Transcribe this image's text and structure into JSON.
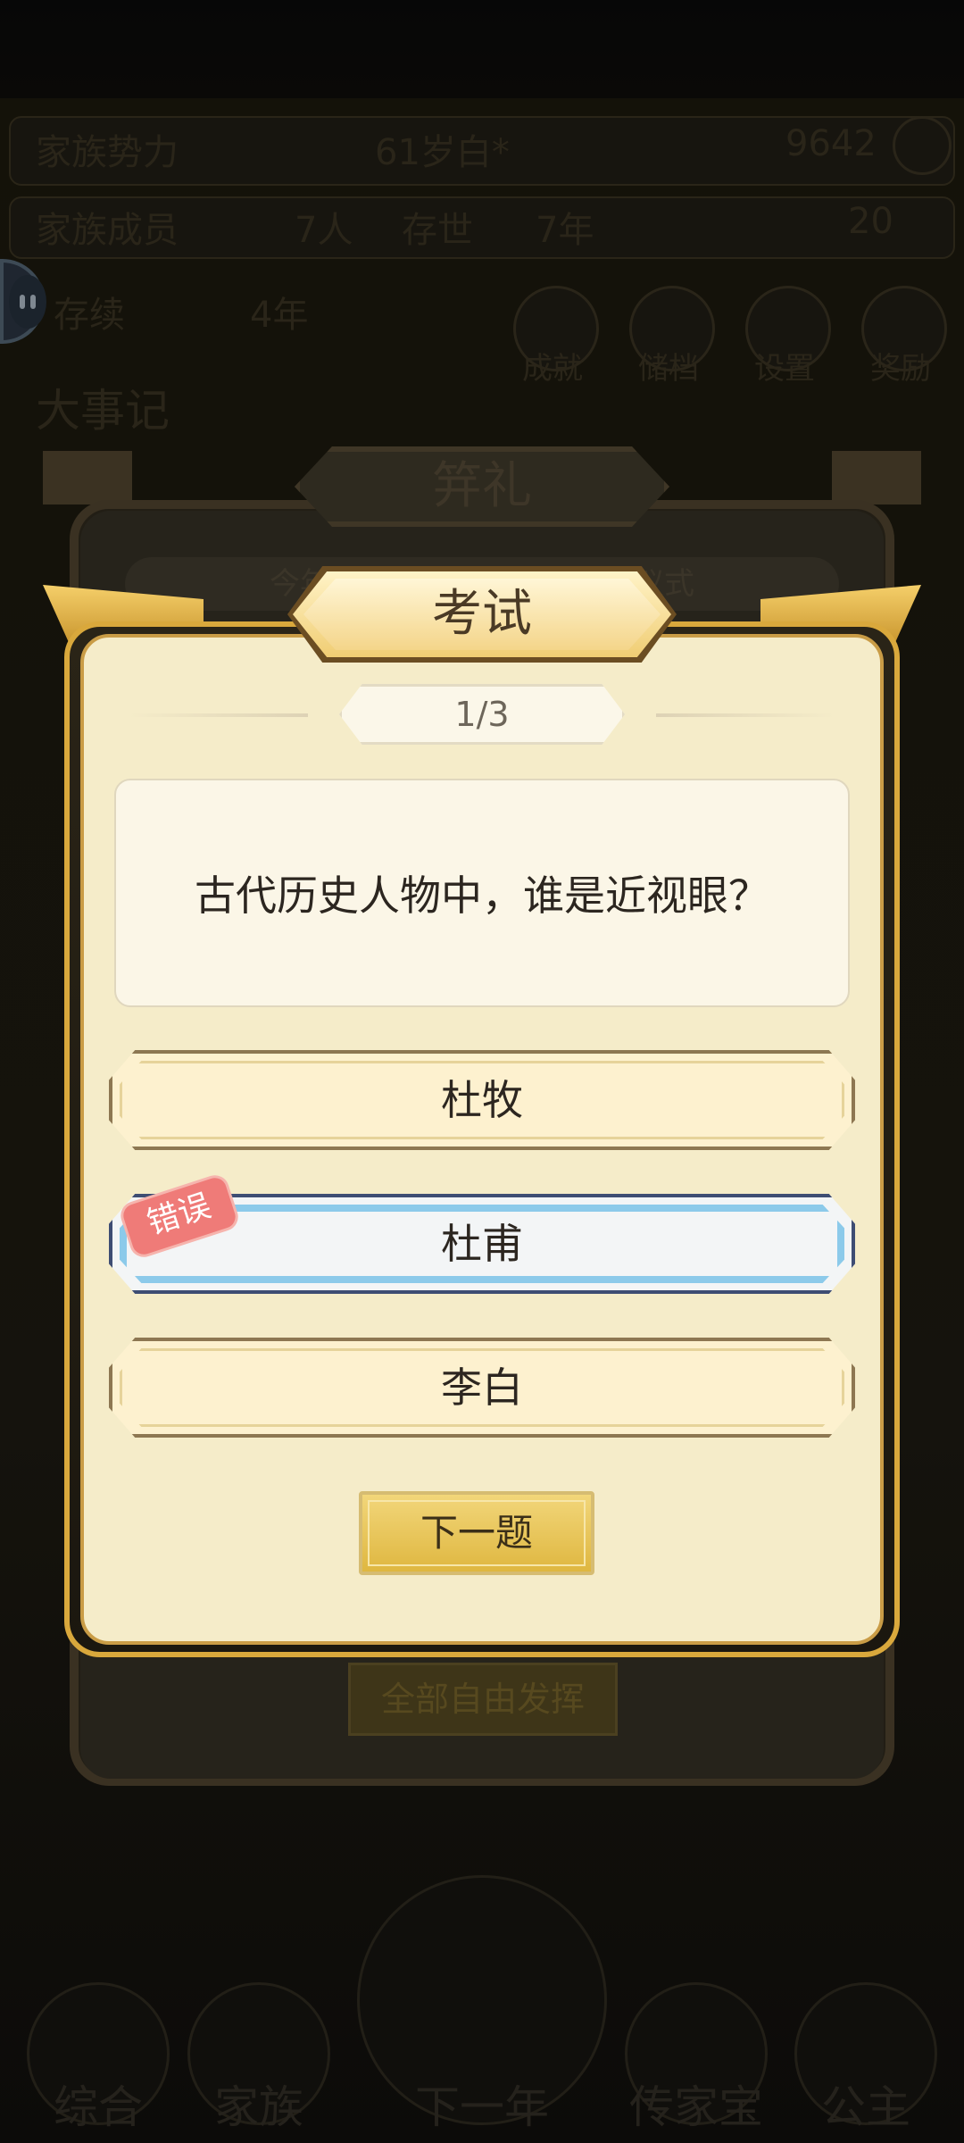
{
  "background": {
    "top_left": "家族势力",
    "top_center": "61岁白*",
    "top_right_value": "9642",
    "row2_left_label": "家族成员",
    "row2_left_value": "7人",
    "row2_mid_label": "存世",
    "row2_mid_value": "7年",
    "row2_right_value": "20",
    "row3_left": "存续",
    "row3_mid": "4年",
    "icon_labels": [
      "成就",
      "储档",
      "设置",
      "奖励"
    ],
    "section_title": "大事记"
  },
  "back_dialog": {
    "title": "笄礼",
    "subtitle": "今年共有家族成员参加笄礼仪式",
    "button": "全部自由发挥"
  },
  "dialog": {
    "title": "考试",
    "progress": "1/3",
    "question": "古代历史人物中，谁是近视眼？",
    "options": [
      "杜牧",
      "杜甫",
      "李白"
    ],
    "selected_index": 1,
    "wrong_label": "错误",
    "next_button": "下一题"
  },
  "bottom_nav": [
    "综合",
    "家族",
    "下一年",
    "传家宝",
    "公主"
  ]
}
